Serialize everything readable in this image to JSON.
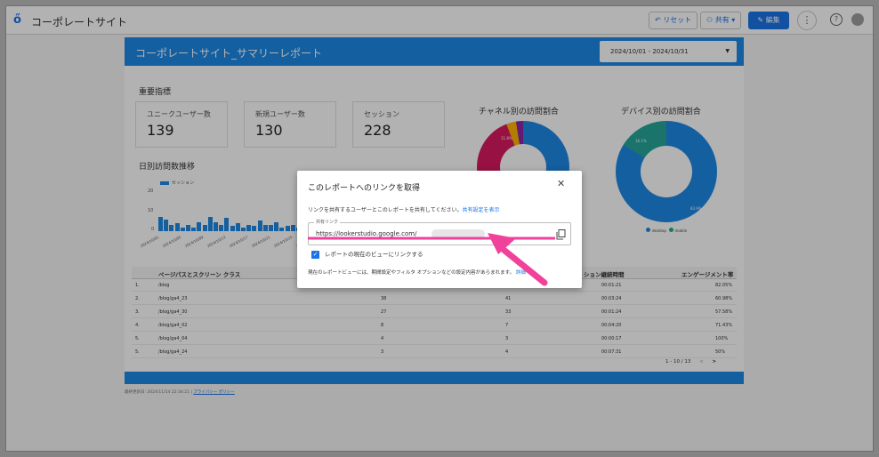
{
  "app": {
    "title": "コーポレートサイト"
  },
  "toolbar": {
    "reset_label": "リセット",
    "share_label": "共有",
    "edit_label": "編集"
  },
  "report": {
    "title": "コーポレートサイト_サマリーレポート",
    "date_range": "2024/10/01 - 2024/10/31",
    "kpi_section_title": "重要指標",
    "kpis": [
      {
        "label": "ユニークユーザー数",
        "value": "139"
      },
      {
        "label": "新規ユーザー数",
        "value": "130"
      },
      {
        "label": "セッション",
        "value": "228"
      }
    ],
    "daily_title": "日別訪問数推移",
    "channel_title": "チャネル別の訪問割合",
    "device_title": "デバイス別の訪問割合",
    "channel_pct_label": "11.8%",
    "device_pct_top": "16.1%",
    "device_pct_main": "83.9%",
    "device_legend": [
      "desktop",
      "mobile"
    ]
  },
  "chart_data": [
    {
      "type": "bar",
      "title": "日別訪問数推移",
      "series": [
        {
          "name": "セッション",
          "values": [
            11,
            9,
            5,
            6,
            3,
            5,
            3,
            7,
            5,
            11,
            7,
            5,
            10,
            4,
            6,
            3,
            5,
            4,
            8,
            5,
            5,
            7,
            3,
            4,
            5,
            3,
            6,
            4,
            2,
            5,
            3
          ]
        }
      ],
      "yticks": [
        "0",
        "10",
        "20"
      ],
      "ylim": [
        0,
        20
      ],
      "xticks": [
        "2024/10/01",
        "2024/10/05",
        "2024/10/09",
        "2024/10/13",
        "2024/10/17",
        "2024/10/21",
        "2024/10/25",
        "2024/10/29"
      ]
    },
    {
      "type": "pie",
      "title": "チャネル別の訪問割合",
      "slices": [
        {
          "label": "",
          "value": 60.3,
          "color": "#1e88e5"
        },
        {
          "label": "",
          "value": 11.8,
          "color": "#26a69a"
        },
        {
          "label": "",
          "value": 22.0,
          "color": "#d81b60"
        },
        {
          "label": "",
          "value": 3.4,
          "color": "#ffb300"
        },
        {
          "label": "",
          "value": 2.5,
          "color": "#8e24aa"
        }
      ]
    },
    {
      "type": "pie",
      "title": "デバイス別の訪問割合",
      "slices": [
        {
          "label": "desktop",
          "value": 83.9,
          "color": "#1e88e5"
        },
        {
          "label": "mobile",
          "value": 16.1,
          "color": "#26a69a"
        }
      ]
    }
  ],
  "table": {
    "headers": [
      "ページパスとスクリーン クラス",
      "ション継続時間",
      "エンゲージメント率"
    ],
    "rows": [
      [
        "1.",
        "/blog",
        "",
        "",
        "00:01:21",
        "82.05%"
      ],
      [
        "2.",
        "/blog/ga4_23",
        "38",
        "41",
        "00:03:24",
        "60.98%"
      ],
      [
        "3.",
        "/blog/ga4_30",
        "27",
        "33",
        "00:01:24",
        "57.58%"
      ],
      [
        "4.",
        "/blog/ga4_02",
        "8",
        "7",
        "00:04:20",
        "71.43%"
      ],
      [
        "5.",
        "/blog/ga4_04",
        "4",
        "3",
        "00:00:17",
        "100%"
      ],
      [
        "5.",
        "/blog/ga4_24",
        "3",
        "4",
        "00:07:31",
        "50%"
      ]
    ],
    "pager": "1 - 10 / 13"
  },
  "footer": {
    "updated": "最終更新日: 2024/11/14 22:34:21",
    "privacy": "プライバシー ポリシー"
  },
  "modal": {
    "title": "このレポートへのリンクを取得",
    "description": "リンクを共有するユーザーとこのレポートを共有してください。",
    "description_link": "共有設定を表示",
    "field_label": "共有リンク",
    "link_value": "https://lookerstudio.google.com/",
    "checkbox_label": "レポートの現在のビューにリンクする",
    "note": "現在のレポートビューには、期間設定やフィルタ オプションなどの設定内容があらまれます。",
    "note_link": "詳細"
  },
  "colors": {
    "accent": "#1e88e5",
    "arrow": "#f0429a"
  }
}
